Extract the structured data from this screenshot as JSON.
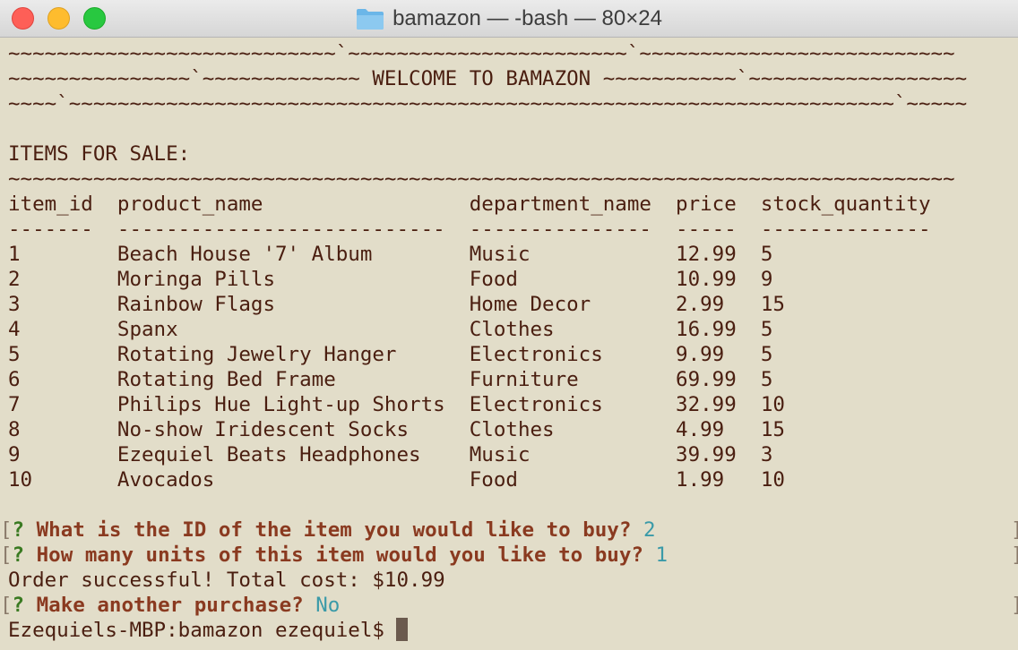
{
  "window": {
    "title": "bamazon — -bash — 80×24"
  },
  "banner": [
    "~~~~~~~~~~~~~~~~~~~~~~~~~~~`~~~~~~~~~~~~~~~~~~~~~~~`~~~~~~~~~~~~~~~~~~~~~~~~~~",
    "~~~~~~~~~~~~~~~`~~~~~~~~~~~~~ WELCOME TO BAMAZON ~~~~~~~~~~~`~~~~~~~~~~~~~~~~~~",
    "~~~~`~~~~~~~~~~~~~~~~~~~~~~~~~~~~~~~~~~~~~~~~~~~~~~~~~~~~~~~~~~~~~~~~~~~~`~~~~~"
  ],
  "items_heading": "ITEMS FOR SALE:",
  "divider": "~~~~~~~~~~~~~~~~~~~~~~~~~~~~~~~~~~~~~~~~~~~~~~~~~~~~~~~~~~~~~~~~~~~~~~~~~~~~~~",
  "table": {
    "header": "item_id  product_name                 department_name  price  stock_quantity",
    "rule": "-------  ---------------------------  ---------------  -----  --------------",
    "rows": [
      "1        Beach House '7' Album        Music            12.99  5",
      "2        Moringa Pills                Food             10.99  9",
      "3        Rainbow Flags                Home Decor       2.99   15",
      "4        Spanx                        Clothes          16.99  5",
      "5        Rotating Jewelry Hanger      Electronics      9.99   5",
      "6        Rotating Bed Frame           Furniture        69.99  5",
      "7        Philips Hue Light-up Shorts  Electronics      32.99  10",
      "8        No-show Iridescent Socks     Clothes          4.99   15",
      "9        Ezequiel Beats Headphones    Music            39.99  3",
      "10       Avocados                     Food             1.99   10"
    ]
  },
  "prompts": {
    "q1": {
      "text": " What is the ID of the item you would like to buy? ",
      "answer": "2"
    },
    "q2": {
      "text": " How many units of this item would you like to buy? ",
      "answer": "1"
    },
    "result": "Order successful! Total cost: $10.99",
    "q3": {
      "text": " Make another purchase? ",
      "answer": "No"
    },
    "open_bracket": "[",
    "question_mark": "?",
    "close_bracket": "]"
  },
  "shell": {
    "prompt": "Ezequiels-MBP:bamazon ezequiel$ "
  }
}
